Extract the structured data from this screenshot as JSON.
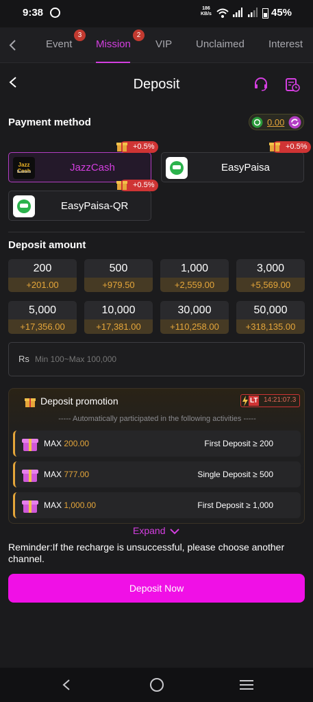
{
  "status_bar": {
    "time": "9:38",
    "speed_top": "186",
    "speed_bottom": "KB/s",
    "battery": "45%"
  },
  "tabs": [
    {
      "label": "Event",
      "badge": "3"
    },
    {
      "label": "Mission",
      "badge": "2"
    },
    {
      "label": "VIP"
    },
    {
      "label": "Unclaimed"
    },
    {
      "label": "Interest"
    }
  ],
  "header": {
    "title": "Deposit"
  },
  "payment": {
    "title": "Payment method",
    "balance": "0.00",
    "methods": [
      {
        "label": "JazzCash",
        "bonus": "+0.5%",
        "selected": true,
        "logo_text_top": "Jazz Cash",
        "logo_text_bottom": "Business"
      },
      {
        "label": "EasyPaisa",
        "bonus": "+0.5%",
        "selected": false
      },
      {
        "label": "EasyPaisa-QR",
        "bonus": "+0.5%",
        "selected": false
      }
    ]
  },
  "deposit_amount": {
    "title": "Deposit amount",
    "options": [
      {
        "value": "200",
        "bonus": "+201.00"
      },
      {
        "value": "500",
        "bonus": "+979.50"
      },
      {
        "value": "1,000",
        "bonus": "+2,559.00"
      },
      {
        "value": "3,000",
        "bonus": "+5,569.00"
      },
      {
        "value": "5,000",
        "bonus": "+17,356.00"
      },
      {
        "value": "10,000",
        "bonus": "+17,381.00"
      },
      {
        "value": "30,000",
        "bonus": "+110,258.00"
      },
      {
        "value": "50,000",
        "bonus": "+318,135.00"
      }
    ],
    "currency": "Rs",
    "placeholder": "Min 100~Max 100,000"
  },
  "promotion": {
    "title": "Deposit promotion",
    "lt_label": "LT",
    "timer": "14:21:07.3",
    "subtitle": "----- Automatically participated in the following activities -----",
    "rows": [
      {
        "max_label": "MAX",
        "max_value": "200.00",
        "condition": "First Deposit ≥ 200"
      },
      {
        "max_label": "MAX",
        "max_value": "777.00",
        "condition": "Single Deposit ≥ 500"
      },
      {
        "max_label": "MAX",
        "max_value": "1,000.00",
        "condition": "First Deposit ≥ 1,000"
      }
    ],
    "expand": "Expand"
  },
  "reminder": "Reminder:If the recharge is unsuccessful, please choose another channel.",
  "deposit_button": "Deposit Now",
  "colors": {
    "accent": "#d43fe0",
    "button": "#f010e6",
    "gold": "#e5a63a",
    "badge_red": "#cf3434"
  }
}
